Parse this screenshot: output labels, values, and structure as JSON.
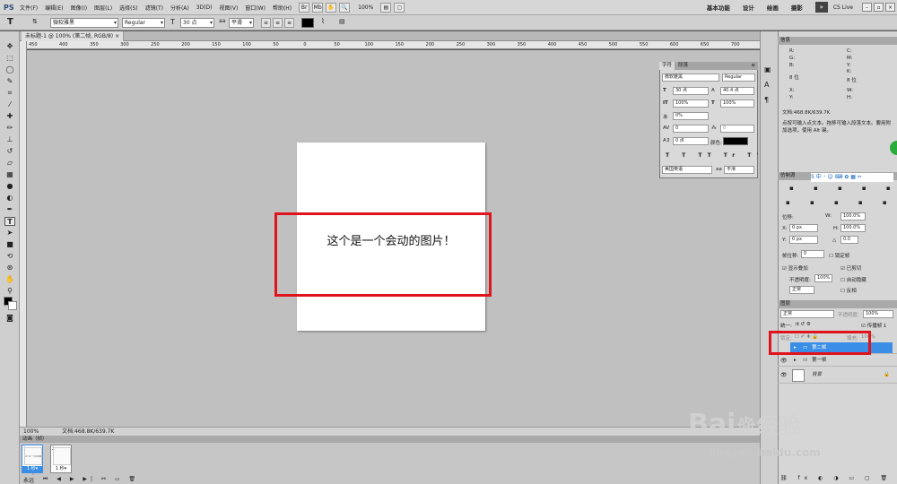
{
  "app": {
    "logo": "PS",
    "menus": [
      "文件(F)",
      "编辑(E)",
      "图像(I)",
      "图层(L)",
      "选择(S)",
      "滤镜(T)",
      "分析(A)",
      "3D(D)",
      "视图(V)",
      "窗口(W)",
      "帮助(H)"
    ],
    "zoom": "100%",
    "workspaces": [
      "基本功能",
      "设计",
      "绘画",
      "摄影"
    ],
    "cs_live": "CS Live"
  },
  "options_bar": {
    "font_family": "微软雅黑",
    "font_style": "Regular",
    "font_size": "30 点",
    "antialias": "平滑"
  },
  "document": {
    "tab_title": "未标题-1 @ 100% (第二帧, RGB/8)",
    "canvas_text": "这个是一个会动的图片！",
    "status_zoom": "100%",
    "status_doc": "文档:468.8K/639.7K",
    "ruler_labels": [
      "450",
      "400",
      "350",
      "300",
      "250",
      "200",
      "150",
      "100",
      "50",
      "0",
      "50",
      "100",
      "150",
      "200",
      "250",
      "300",
      "350",
      "400",
      "450",
      "500",
      "550",
      "600",
      "650",
      "700"
    ],
    "accent_red": "#e0141c"
  },
  "animation": {
    "title": "动画（帧）",
    "frames": [
      {
        "num": "1",
        "delay": "1 秒▾",
        "thumb": "这个是一个会动的图片"
      },
      {
        "num": "2",
        "delay": "1 秒▾",
        "thumb": ""
      }
    ],
    "loop": "永远"
  },
  "character_panel": {
    "tabs": [
      "字符",
      "段落"
    ],
    "font_family": "微软雅黑",
    "font_style": "Regular",
    "size": "30 点",
    "leading": "40.4 点",
    "vscale": "100%",
    "hscale": "100%",
    "tracking": "0%",
    "kerning": "0",
    "kern_auto": "0",
    "baseline": "0 点",
    "color_label": "颜色:",
    "language": "美国英语",
    "antialias": "平滑"
  },
  "info_panel": {
    "title": "信息",
    "labels": [
      "R:",
      "G:",
      "B:",
      "8 位",
      "C:",
      "M:",
      "Y:",
      "K:",
      "8 位",
      "X:",
      "Y:",
      "W:",
      "H:"
    ],
    "doc": "文档:468.8K/639.7K",
    "hint": "点按可输入点文本。拖移可输入段落文本。要用附加选项，使用 Alt 键。"
  },
  "clone_panel": {
    "title": "仿制源",
    "offset_label": "位移:",
    "x": "0 px",
    "y": "0 px",
    "w": "100.0%",
    "h": "100.0%",
    "angle": "0.0",
    "frame_offset_label": "帧位移:",
    "frame_offset": "0",
    "lock_frame": "锁定帧",
    "show_overlay": "显示叠加",
    "opacity_label": "不透明度:",
    "opacity": "100%",
    "clipped": "已剪切",
    "auto_hide": "自动隐藏",
    "blend": "正常",
    "invert": "反相"
  },
  "layers_panel": {
    "title": "图层",
    "blend_mode": "正常",
    "opacity_label": "不透明度:",
    "opacity": "100%",
    "unify_label": "统一:",
    "propagate": "传播帧 1",
    "lock_label": "锁定:",
    "fill_label": "填充:",
    "fill": "100%",
    "layers": [
      {
        "name": "第二帧",
        "type": "group",
        "selected": true
      },
      {
        "name": "第一帧",
        "type": "group",
        "selected": false
      },
      {
        "name": "背景",
        "type": "background",
        "selected": false
      }
    ]
  },
  "watermark": {
    "brand": "Bai",
    "brand2": "经验",
    "url": "jingyan.baidu.com"
  }
}
